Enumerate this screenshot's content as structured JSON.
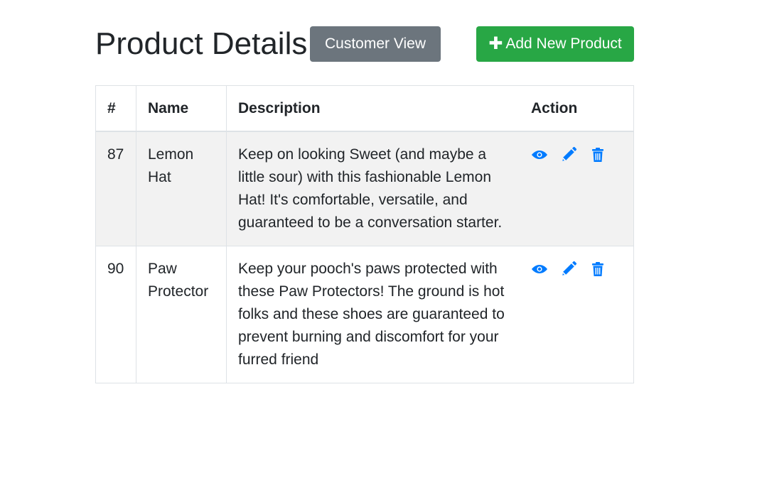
{
  "header": {
    "title": "Product Details",
    "customer_view_label": "Customer View",
    "add_product_label": "Add New Product",
    "add_product_icon": "plus-icon"
  },
  "colors": {
    "primary": "#007bff",
    "secondary": "#6c757d",
    "success": "#28a745",
    "stripe": "#f2f2f2"
  },
  "table": {
    "columns": [
      "#",
      "Name",
      "Description",
      "Action"
    ],
    "rows": [
      {
        "id": "87",
        "name": "Lemon Hat",
        "description": "Keep on looking Sweet (and maybe a little sour) with this fashionable Lemon Hat! It's comfortable, versatile, and guaranteed to be a conversation starter.",
        "actions": [
          "eye-icon",
          "pencil-icon",
          "trash-icon"
        ]
      },
      {
        "id": "90",
        "name": "Paw Protector",
        "description": "Keep your pooch's paws protected with these Paw Protectors! The ground is hot folks and these shoes are guaranteed to prevent burning and discomfort for your furred friend",
        "actions": [
          "eye-icon",
          "pencil-icon",
          "trash-icon"
        ]
      }
    ]
  }
}
